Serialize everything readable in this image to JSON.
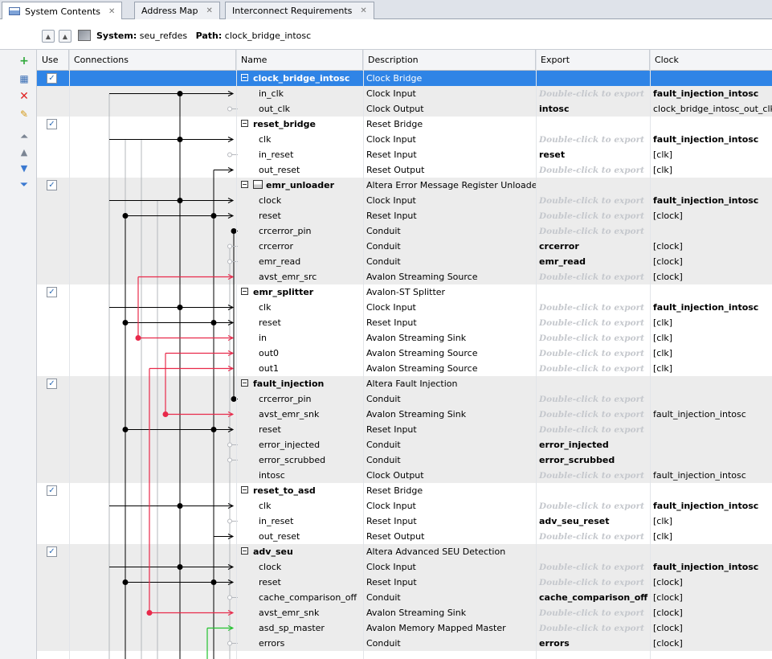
{
  "tabs": [
    {
      "label": "System Contents",
      "active": true
    },
    {
      "label": "Address Map",
      "active": false
    },
    {
      "label": "Interconnect Requirements",
      "active": false
    }
  ],
  "path": {
    "system_label": "System:",
    "system_value": "seu_refdes",
    "path_label": "Path:",
    "path_value": "clock_bridge_intosc"
  },
  "columns": {
    "use": "Use",
    "connections": "Connections",
    "name": "Name",
    "description": "Description",
    "export": "Export",
    "clock": "Clock"
  },
  "export_hint": "Double-click to export",
  "colors": {
    "selection": "#2f84e6",
    "red_wire": "#e8294a",
    "green_wire": "#22c22e",
    "header_bg": "#f4f5f7"
  },
  "icons": [
    "add-icon",
    "connect-icon",
    "remove-icon",
    "edit-icon",
    "move-top-icon",
    "move-up-icon",
    "move-down-icon",
    "move-bottom-icon"
  ],
  "rows": [
    {
      "type": "group",
      "name": "clock_bridge_intosc",
      "description": "Clock Bridge",
      "export": "",
      "clock": "",
      "use": true,
      "selected": true
    },
    {
      "type": "port",
      "name": "in_clk",
      "description": "Clock Input",
      "export": "",
      "clock": "fault_injection_intosc",
      "clock_bold": true
    },
    {
      "type": "port",
      "name": "out_clk",
      "description": "Clock Output",
      "export": "intosc",
      "clock": "clock_bridge_intosc_out_clk"
    },
    {
      "type": "group",
      "name": "reset_bridge",
      "description": "Reset Bridge",
      "export": "",
      "clock": "",
      "use": true
    },
    {
      "type": "port",
      "name": "clk",
      "description": "Clock Input",
      "export": "",
      "clock": "fault_injection_intosc",
      "clock_bold": true
    },
    {
      "type": "port",
      "name": "in_reset",
      "description": "Reset Input",
      "export": "reset",
      "clock": "[clk]"
    },
    {
      "type": "port",
      "name": "out_reset",
      "description": "Reset Output",
      "export": "",
      "clock": "[clk]"
    },
    {
      "type": "group",
      "name": "emr_unloader",
      "description": "Altera Error Message Register Unloader",
      "export": "",
      "clock": "",
      "use": true,
      "icon": true
    },
    {
      "type": "port",
      "name": "clock",
      "description": "Clock Input",
      "export": "",
      "clock": "fault_injection_intosc",
      "clock_bold": true
    },
    {
      "type": "port",
      "name": "reset",
      "description": "Reset Input",
      "export": "",
      "clock": "[clock]"
    },
    {
      "type": "port",
      "name": "crcerror_pin",
      "description": "Conduit",
      "export": "",
      "clock": ""
    },
    {
      "type": "port",
      "name": "crcerror",
      "description": "Conduit",
      "export": "crcerror",
      "clock": "[clock]"
    },
    {
      "type": "port",
      "name": "emr_read",
      "description": "Conduit",
      "export": "emr_read",
      "clock": "[clock]"
    },
    {
      "type": "port",
      "name": "avst_emr_src",
      "description": "Avalon Streaming Source",
      "export": "",
      "clock": "[clock]"
    },
    {
      "type": "group",
      "name": "emr_splitter",
      "description": "Avalon-ST Splitter",
      "export": "",
      "clock": "",
      "use": true
    },
    {
      "type": "port",
      "name": "clk",
      "description": "Clock Input",
      "export": "",
      "clock": "fault_injection_intosc",
      "clock_bold": true
    },
    {
      "type": "port",
      "name": "reset",
      "description": "Reset Input",
      "export": "",
      "clock": "[clk]"
    },
    {
      "type": "port",
      "name": "in",
      "description": "Avalon Streaming Sink",
      "export": "",
      "clock": "[clk]"
    },
    {
      "type": "port",
      "name": "out0",
      "description": "Avalon Streaming Source",
      "export": "",
      "clock": "[clk]"
    },
    {
      "type": "port",
      "name": "out1",
      "description": "Avalon Streaming Source",
      "export": "",
      "clock": "[clk]"
    },
    {
      "type": "group",
      "name": "fault_injection",
      "description": "Altera Fault Injection",
      "export": "",
      "clock": "",
      "use": true
    },
    {
      "type": "port",
      "name": "crcerror_pin",
      "description": "Conduit",
      "export": "",
      "clock": ""
    },
    {
      "type": "port",
      "name": "avst_emr_snk",
      "description": "Avalon Streaming Sink",
      "export": "",
      "clock": "fault_injection_intosc"
    },
    {
      "type": "port",
      "name": "reset",
      "description": "Reset Input",
      "export": "",
      "clock": ""
    },
    {
      "type": "port",
      "name": "error_injected",
      "description": "Conduit",
      "export": "error_injected",
      "clock": ""
    },
    {
      "type": "port",
      "name": "error_scrubbed",
      "description": "Conduit",
      "export": "error_scrubbed",
      "clock": ""
    },
    {
      "type": "port",
      "name": "intosc",
      "description": "Clock Output",
      "export": "",
      "clock": "fault_injection_intosc"
    },
    {
      "type": "group",
      "name": "reset_to_asd",
      "description": "Reset Bridge",
      "export": "",
      "clock": "",
      "use": true
    },
    {
      "type": "port",
      "name": "clk",
      "description": "Clock Input",
      "export": "",
      "clock": "fault_injection_intosc",
      "clock_bold": true
    },
    {
      "type": "port",
      "name": "in_reset",
      "description": "Reset Input",
      "export": "adv_seu_reset",
      "clock": "[clk]"
    },
    {
      "type": "port",
      "name": "out_reset",
      "description": "Reset Output",
      "export": "",
      "clock": "[clk]"
    },
    {
      "type": "group",
      "name": "adv_seu",
      "description": "Altera Advanced SEU Detection",
      "export": "",
      "clock": "",
      "use": true
    },
    {
      "type": "port",
      "name": "clock",
      "description": "Clock Input",
      "export": "",
      "clock": "fault_injection_intosc",
      "clock_bold": true
    },
    {
      "type": "port",
      "name": "reset",
      "description": "Reset Input",
      "export": "",
      "clock": "[clock]"
    },
    {
      "type": "port",
      "name": "cache_comparison_off",
      "description": "Conduit",
      "export": "cache_comparison_off",
      "clock": "[clock]"
    },
    {
      "type": "port",
      "name": "avst_emr_snk",
      "description": "Avalon Streaming Sink",
      "export": "",
      "clock": "[clock]"
    },
    {
      "type": "port",
      "name": "asd_sp_master",
      "description": "Avalon Memory Mapped Master",
      "export": "",
      "clock": "[clock]"
    },
    {
      "type": "port",
      "name": "errors",
      "description": "Conduit",
      "export": "errors",
      "clock": "[clock]"
    }
  ]
}
